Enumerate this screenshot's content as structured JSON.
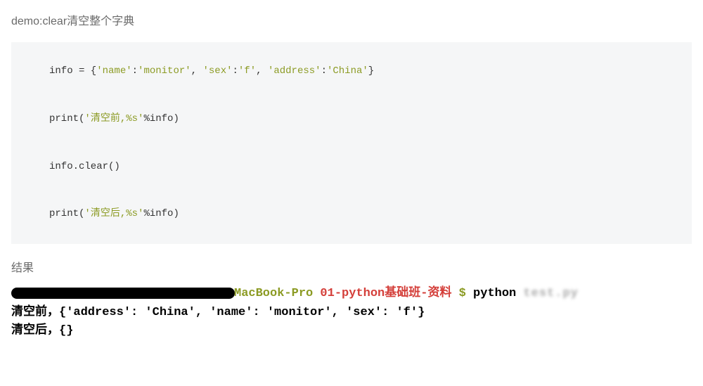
{
  "title": "demo:clear清空整个字典",
  "code": {
    "l1_pre": "info = {",
    "l1_k1": "'name'",
    "l1_c1": ":",
    "l1_v1": "'monitor'",
    "l1_s1": ", ",
    "l1_k2": "'sex'",
    "l1_c2": ":",
    "l1_v2": "'f'",
    "l1_s2": ", ",
    "l1_k3": "'address'",
    "l1_c3": ":",
    "l1_v3": "'China'",
    "l1_post": "}",
    "l2_pre": "print(",
    "l2_str": "'清空前,%s'",
    "l2_post": "%info)",
    "l3": "info.clear()",
    "l4_pre": "print(",
    "l4_str": "'清空后,%s'",
    "l4_post": "%info)"
  },
  "result_label": "结果",
  "terminal": {
    "host": "MacBook-Pro ",
    "path": "01-python基础班-资料 ",
    "prompt": "$ ",
    "cmd": "python ",
    "cmd_tail": "test.py",
    "out1": "清空前，{'address': 'China', 'name': 'monitor', 'sex': 'f'}",
    "out2": "清空后，{}"
  }
}
